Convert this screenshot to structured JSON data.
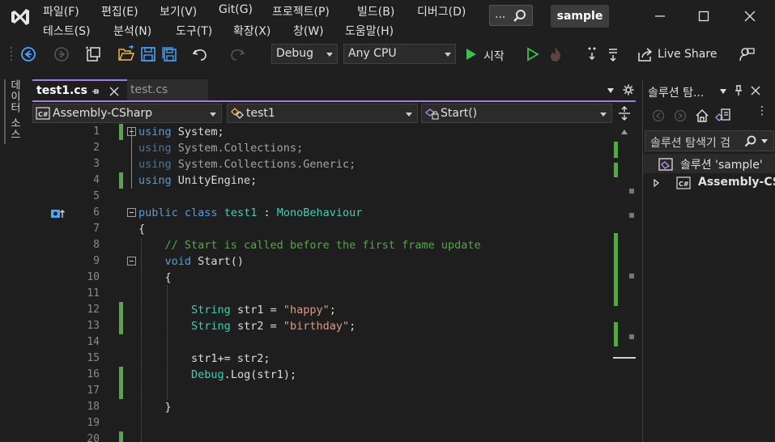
{
  "app": {
    "project_name": "sample",
    "search_dots": "..."
  },
  "menu": [
    "파일(F)",
    "편집(E)",
    "보기(V)",
    "Git(G)",
    "프로젝트(P)",
    "빌드(B)",
    "디버그(D)",
    "테스트(S)",
    "분석(N)",
    "도구(T)",
    "확장(X)",
    "창(W)",
    "도움말(H)"
  ],
  "toolbar": {
    "configuration": "Debug",
    "platform": "Any CPU",
    "start_label": "시작",
    "live_share_label": "Live Share"
  },
  "left_panel": {
    "label": "데이터 소스"
  },
  "tabs": [
    {
      "label": "test1.cs",
      "active": true
    },
    {
      "label": "test.cs",
      "active": false
    }
  ],
  "nav": {
    "project": "Assembly-CSharp",
    "class": "test1",
    "member": "Start()"
  },
  "editor": {
    "lines": [
      {
        "n": "1",
        "t": [
          [
            "kw",
            "using"
          ],
          [
            "pl",
            " System;"
          ]
        ]
      },
      {
        "n": "2",
        "t": [
          [
            "kw",
            "using"
          ],
          [
            "pl",
            " System.Collections;"
          ]
        ]
      },
      {
        "n": "3",
        "t": [
          [
            "kw",
            "using"
          ],
          [
            "pl",
            " System.Collections.Generic;"
          ]
        ]
      },
      {
        "n": "4",
        "t": [
          [
            "kw",
            "using"
          ],
          [
            "pl",
            " UnityEngine;"
          ]
        ]
      },
      {
        "n": "5",
        "t": []
      },
      {
        "n": "6",
        "t": [
          [
            "kw",
            "public"
          ],
          [
            "pl",
            " "
          ],
          [
            "kw",
            "class"
          ],
          [
            "pl",
            " "
          ],
          [
            "ty",
            "test1"
          ],
          [
            "pl",
            " : "
          ],
          [
            "ty",
            "MonoBehaviour"
          ]
        ]
      },
      {
        "n": "7",
        "t": [
          [
            "pl",
            "{"
          ]
        ]
      },
      {
        "n": "8",
        "t": [
          [
            "pl",
            "    "
          ],
          [
            "cm",
            "// Start is called before the first frame update"
          ]
        ]
      },
      {
        "n": "9",
        "t": [
          [
            "pl",
            "    "
          ],
          [
            "kw",
            "void"
          ],
          [
            "pl",
            " Start()"
          ]
        ]
      },
      {
        "n": "10",
        "t": [
          [
            "pl",
            "    {"
          ]
        ]
      },
      {
        "n": "11",
        "t": []
      },
      {
        "n": "12",
        "t": [
          [
            "pl",
            "        "
          ],
          [
            "ty",
            "String"
          ],
          [
            "pl",
            " str1 = "
          ],
          [
            "st",
            "\"happy\""
          ],
          [
            "pl",
            ";"
          ]
        ]
      },
      {
        "n": "13",
        "t": [
          [
            "pl",
            "        "
          ],
          [
            "ty",
            "String"
          ],
          [
            "pl",
            " str2 = "
          ],
          [
            "st",
            "\"birthday\""
          ],
          [
            "pl",
            ";"
          ]
        ]
      },
      {
        "n": "14",
        "t": []
      },
      {
        "n": "15",
        "t": [
          [
            "pl",
            "        str1+= str2;"
          ]
        ]
      },
      {
        "n": "16",
        "t": [
          [
            "pl",
            "        "
          ],
          [
            "ty",
            "Debug"
          ],
          [
            "pl",
            "."
          ],
          [
            "pl",
            "Log(str1);"
          ]
        ]
      },
      {
        "n": "17",
        "t": []
      },
      {
        "n": "18",
        "t": [
          [
            "pl",
            "    }"
          ]
        ]
      },
      {
        "n": "19",
        "t": []
      },
      {
        "n": "20",
        "t": []
      }
    ]
  },
  "solution_explorer": {
    "title": "솔루션 탐...",
    "search_placeholder": "솔루션 탐색기 검",
    "solution_label": "솔루션 'sample'",
    "project_label": "Assembly-CSharp"
  },
  "colors": {
    "accent": "#9f7ee6",
    "change_marker": "#57a64a",
    "keyword": "#569cd6",
    "type": "#4ec9b0",
    "comment": "#57a64a",
    "string": "#d69d85"
  }
}
